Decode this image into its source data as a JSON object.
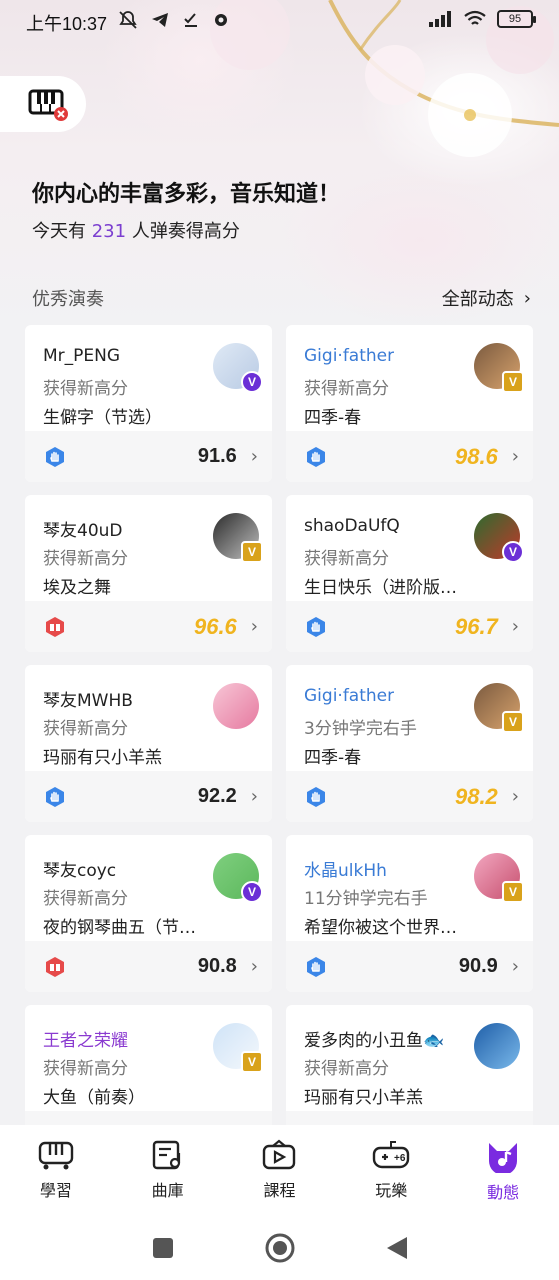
{
  "status_bar": {
    "time": "上午10:37",
    "battery": "95"
  },
  "header": {
    "headline": "你内心的丰富多彩，音乐知道！",
    "sub_prefix": "今天有",
    "sub_count": "231",
    "sub_suffix": "人弹奏得高分"
  },
  "section": {
    "title": "优秀演奏",
    "more": "全部动态"
  },
  "cards": [
    {
      "name": "Mr_PENG",
      "action": "获得新高分",
      "song": "生僻字（节选）",
      "score": "91.6",
      "mode": "hand",
      "badge": "V",
      "badge_color": "purple"
    },
    {
      "name": "Gigi·father",
      "action": "获得新高分",
      "song": "四季-春",
      "score": "98.6",
      "mode": "hand",
      "badge": "V",
      "badge_color": "gold"
    },
    {
      "name": "琴友40uD",
      "action": "获得新高分",
      "song": "埃及之舞",
      "score": "96.6",
      "mode": "book",
      "badge": "V",
      "badge_color": "gold"
    },
    {
      "name": "shaoDaUfQ",
      "action": "获得新高分",
      "song": "生日快乐（进阶版…",
      "score": "96.7",
      "mode": "hand",
      "badge": "V",
      "badge_color": "purple"
    },
    {
      "name": "琴友MWHB",
      "action": "获得新高分",
      "song": "玛丽有只小羊羔",
      "score": "92.2",
      "mode": "hand",
      "badge": "",
      "badge_color": ""
    },
    {
      "name": "Gigi·father",
      "action": "3分钟学完右手",
      "song": "四季-春",
      "score": "98.2",
      "mode": "hand",
      "badge": "V",
      "badge_color": "gold"
    },
    {
      "name": "琴友coyc",
      "action": "获得新高分",
      "song": "夜的钢琴曲五（节…",
      "score": "90.8",
      "mode": "book",
      "badge": "V",
      "badge_color": "purple"
    },
    {
      "name": "水晶ulkHh",
      "action": "11分钟学完右手",
      "song": "希望你被这个世界…",
      "score": "90.9",
      "mode": "hand",
      "badge": "V",
      "badge_color": "gold"
    },
    {
      "name": "王者之荣耀",
      "action": "获得新高分",
      "song": "大鱼（前奏）",
      "score": "",
      "mode": "hand",
      "badge": "V",
      "badge_color": "gold"
    },
    {
      "name": "爱多肉的小丑鱼🐟",
      "action": "获得新高分",
      "song": "玛丽有只小羊羔",
      "score": "",
      "mode": "hand",
      "badge": "",
      "badge_color": ""
    }
  ],
  "bottom_nav": [
    {
      "label": "學習",
      "icon": "piano-keys-icon"
    },
    {
      "label": "曲庫",
      "icon": "music-sheet-icon"
    },
    {
      "label": "課程",
      "icon": "video-course-icon"
    },
    {
      "label": "玩樂",
      "icon": "gamepad-icon"
    },
    {
      "label": "動態",
      "icon": "feed-music-icon",
      "active": true
    }
  ],
  "colors": {
    "accent_purple": "#7a2be0",
    "score_gold": "#f0b41f",
    "name_blue": "#3a7bd5",
    "mode_hand_blue": "#3b86e8",
    "mode_book_red": "#e64a4a"
  }
}
